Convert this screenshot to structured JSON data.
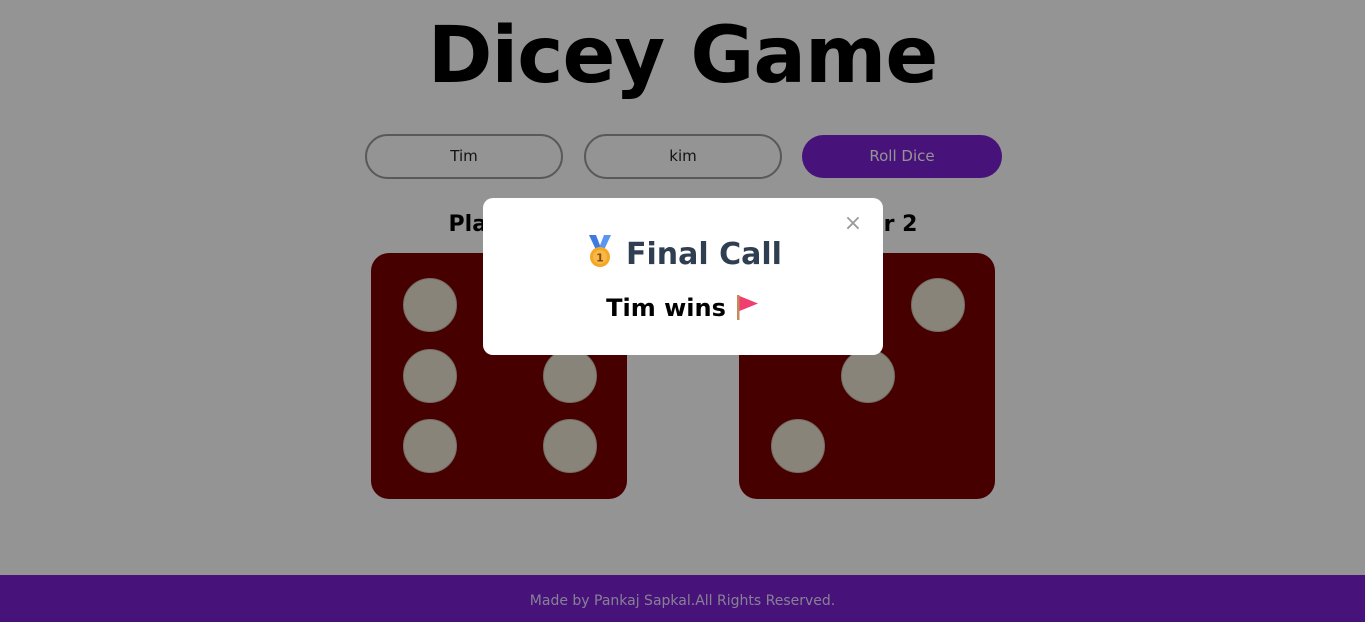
{
  "app": {
    "title": "Dicey Game"
  },
  "controls": {
    "player1_value": "Tim",
    "player2_value": "kim",
    "roll_label": "Roll Dice"
  },
  "players": [
    {
      "label": "Player 1",
      "dice_value": 6
    },
    {
      "label": "Player 2",
      "dice_value": 3
    }
  ],
  "modal": {
    "title": "Final Call",
    "message": "Tim wins",
    "close_symbol": "×",
    "title_icon": "medal-icon",
    "message_icon": "flag-icon"
  },
  "footer": {
    "text": "Made by Pankaj Sapkal.All Rights Reserved."
  },
  "colors": {
    "accent": "#7b1fd1",
    "dice": "#7a0000",
    "dot": "#ebe3d2",
    "modal_title": "#2f3e51"
  }
}
